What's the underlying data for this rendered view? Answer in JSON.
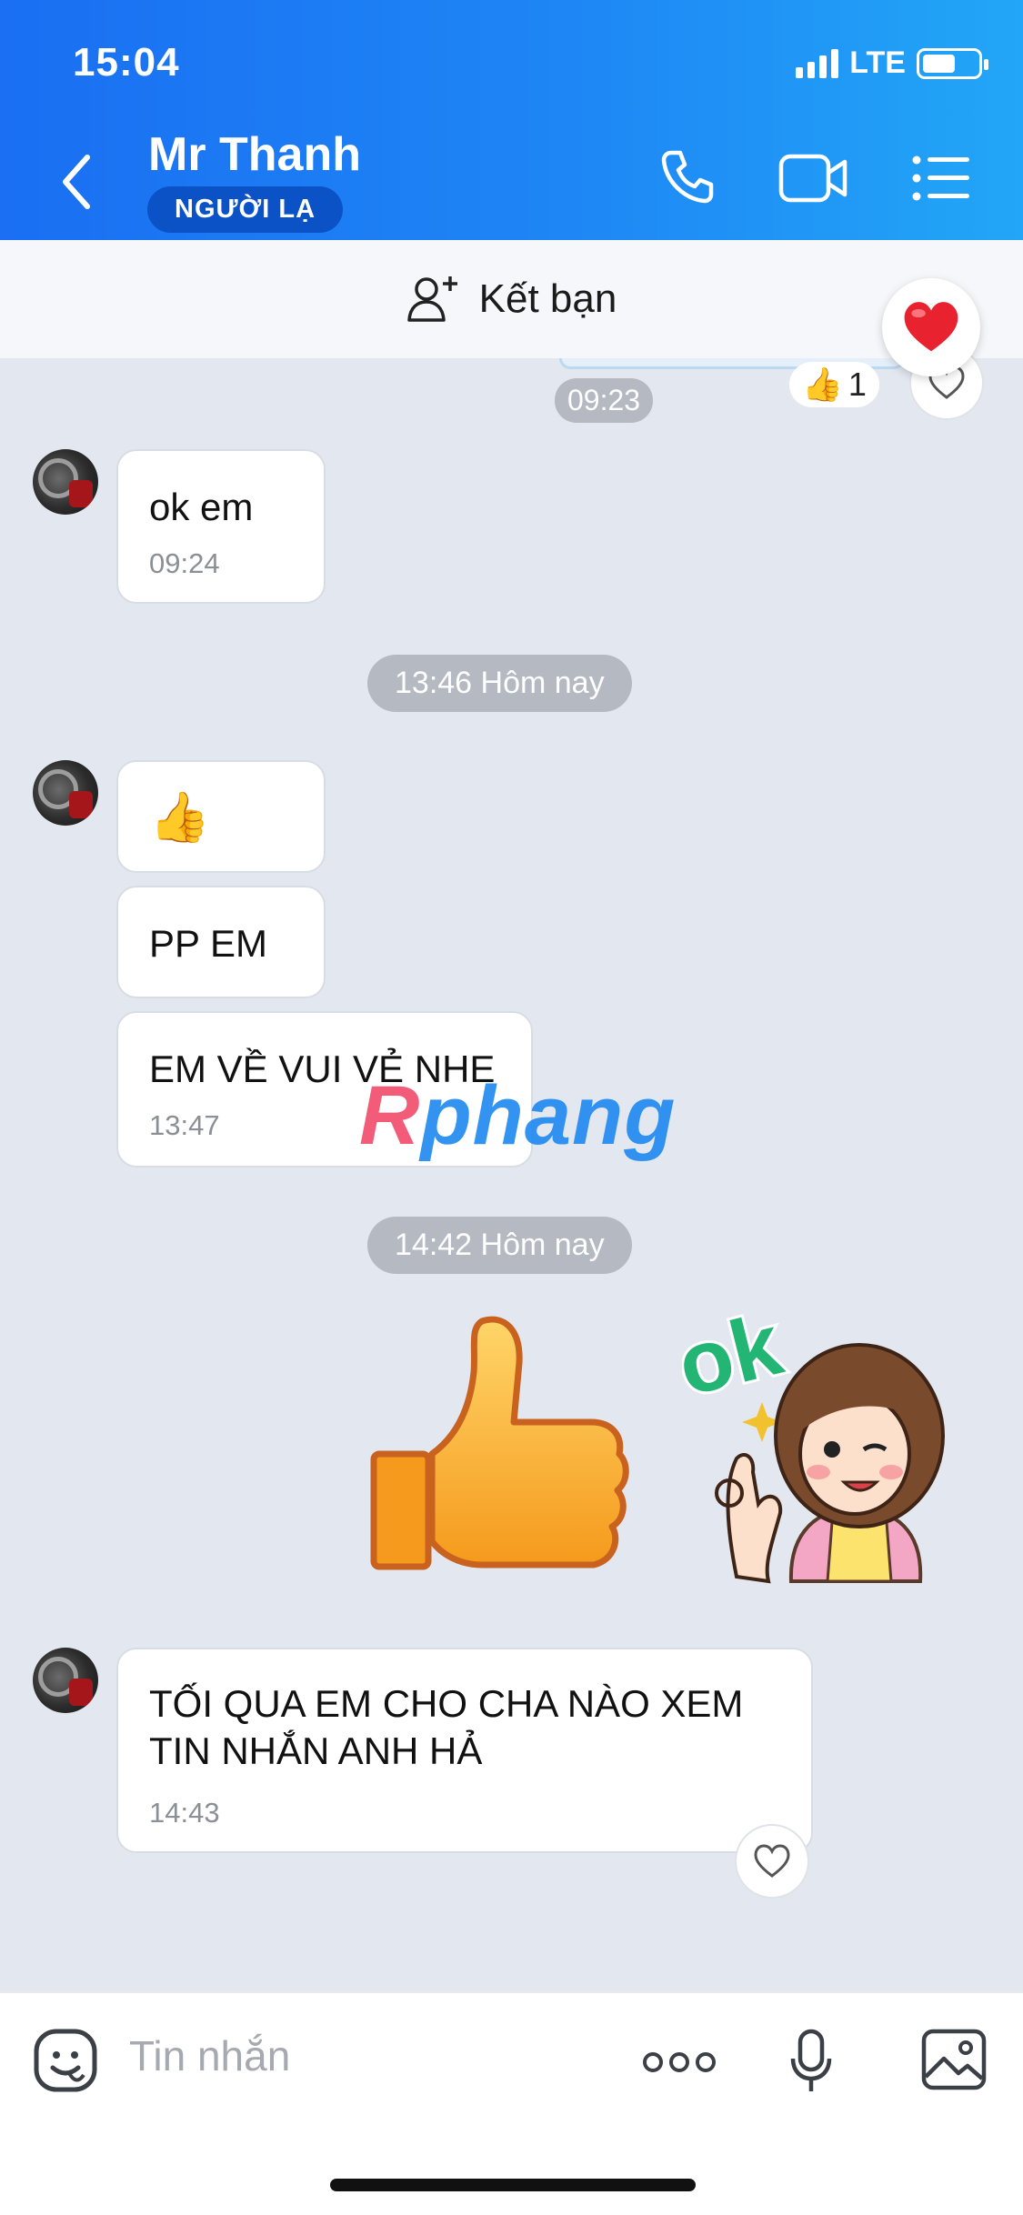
{
  "status_bar": {
    "time": "15:04",
    "network": "LTE"
  },
  "header": {
    "title": "Mr Thanh",
    "badge": "NGƯỜI LẠ",
    "icons": [
      "back-icon",
      "phone-icon",
      "video-call-icon",
      "list-menu-icon"
    ]
  },
  "friend_bar": {
    "label": "Kết bạn",
    "icon": "add-user-icon"
  },
  "floating_reaction": {
    "icon": "heart-icon",
    "color": "#e8232f"
  },
  "messages": {
    "prev_reaction_count": "1",
    "prev_time": "09:23",
    "m1": {
      "text": "ok em",
      "time": "09:24"
    },
    "sep1": "13:46 Hôm nay",
    "m2": {
      "emoji": "👍"
    },
    "m3": {
      "text": "PP EM"
    },
    "m4": {
      "text": "EM VỀ VUI VẺ NHE",
      "time": "13:47"
    },
    "sep2": "14:42 Hôm nay",
    "stickers": [
      {
        "name": "thumbs-up-sticker"
      },
      {
        "name": "ok-girl-sticker",
        "text": "ok"
      }
    ],
    "m5": {
      "line1": "TỐI QUA EM CHO CHA NÀO XEM",
      "line2": "TIN NHẮN ANH HẢ",
      "time": "14:43"
    }
  },
  "watermark": {
    "r": "R",
    "rest": "phang"
  },
  "input": {
    "placeholder": "Tin nhắn"
  },
  "colors": {
    "header_start": "#1a6ff2",
    "header_end": "#22a6f7",
    "chat_bg": "#e3e8f0",
    "badge_bg": "#0a52c6"
  }
}
